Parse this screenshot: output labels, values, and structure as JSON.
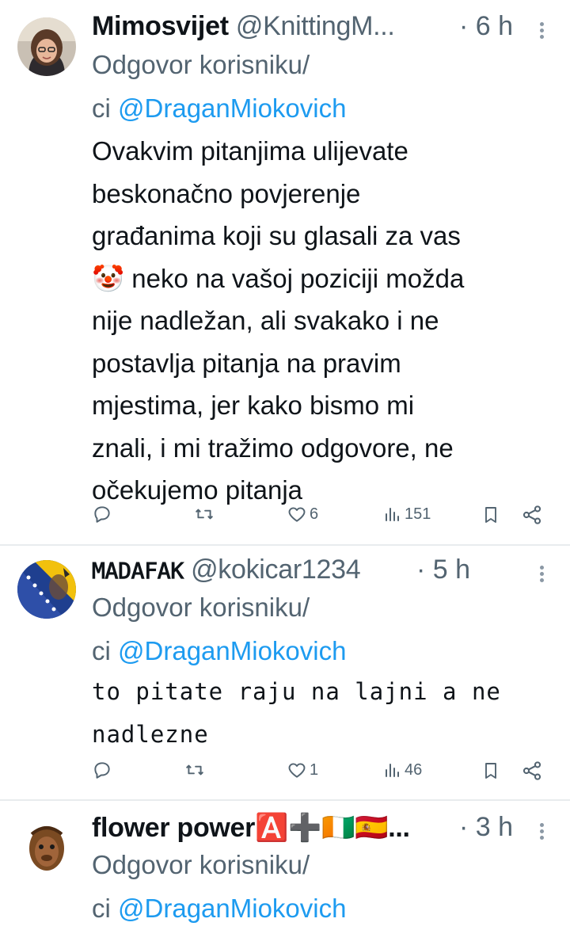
{
  "tweets": [
    {
      "display_name": "Mimosvijet",
      "handle": "@KnittingM...",
      "time": "· 6 h",
      "reply_prefix_1": "Odgovor korisniku/",
      "reply_prefix_2": "ci",
      "mention": "@DraganMiokovich",
      "text_lines": [
        "Ovakvim pitanjima ulijevate",
        "beskonačno povjerenje",
        "građanima koji su glasali za vas",
        "🤡 neko na vašoj poziciji možda",
        "nije nadležan, ali svakako i ne",
        "postavlja pitanja na pravim",
        "mjestima, jer kako bismo mi",
        "znali, i mi tražimo odgovore, ne",
        "očekujemo pitanja"
      ],
      "likes": "6",
      "views": "151"
    },
    {
      "display_name": "𝙼𝙰𝙳𝙰𝙵𝙰𝙺",
      "handle": "@kokicar1234",
      "time": "· 5 h",
      "reply_prefix_1": "Odgovor korisniku/",
      "reply_prefix_2": "ci",
      "mention": "@DraganMiokovich",
      "text_lines": [
        "to pitate raju na lajni a ne",
        "nadlezne"
      ],
      "likes": "1",
      "views": "46"
    },
    {
      "display_name": "flower power🅰️➕🇨🇮🇪🇸...",
      "time": "· 3 h",
      "reply_prefix_1": "Odgovor korisniku/",
      "reply_prefix_2": "ci",
      "mention": "@DraganMiokovich"
    }
  ],
  "icons": {
    "reply": "reply-icon",
    "retweet": "retweet-icon",
    "like": "heart-icon",
    "views": "views-icon",
    "bookmark": "bookmark-icon",
    "share": "share-icon",
    "more": "more-icon"
  },
  "colors": {
    "text": "#0f1419",
    "muted": "#536471",
    "link": "#1d9bf0",
    "divider": "#e8ecee"
  }
}
